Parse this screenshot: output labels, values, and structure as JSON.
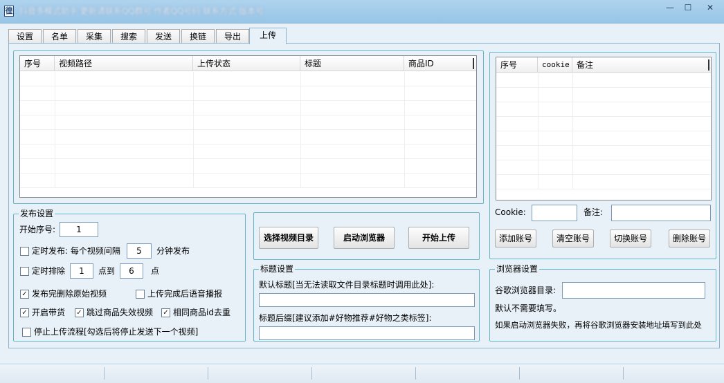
{
  "window": {
    "app_icon": "徨",
    "title": "抖音多模式助手 更新请联系QQ群号 作者QQ号码 联系方式 版本号",
    "controls": {
      "minimize": "—",
      "maximize": "☐",
      "close": "✕"
    }
  },
  "tabs": [
    {
      "label": "设置"
    },
    {
      "label": "名单"
    },
    {
      "label": "采集"
    },
    {
      "label": "搜索"
    },
    {
      "label": "发送"
    },
    {
      "label": "换链"
    },
    {
      "label": "导出"
    },
    {
      "label": "上传",
      "active": true
    }
  ],
  "video_table": {
    "columns": [
      "序号",
      "视频路径",
      "上传状态",
      "标题",
      "商品ID"
    ],
    "rows": []
  },
  "account_table": {
    "columns": [
      "序号",
      "cookie",
      "备注"
    ],
    "rows": []
  },
  "account_form": {
    "cookie_label": "Cookie:",
    "cookie_value": "",
    "note_label": "备注:",
    "note_value": "",
    "buttons": [
      "添加账号",
      "清空账号",
      "切换账号",
      "删除账号"
    ]
  },
  "publish_settings": {
    "title": "发布设置",
    "start_index_label": "开始序号:",
    "start_index_value": "1",
    "timed_publish_label": "定时发布: 每个视频间隔",
    "timed_publish_checked": false,
    "interval_value": "5",
    "interval_unit": "分钟发布",
    "timed_schedule_label": "定时排除",
    "timed_schedule_checked": false,
    "schedule_from": "1",
    "schedule_to_label": "点到",
    "schedule_to": "6",
    "schedule_unit": "点",
    "delete_after_publish_label": "发布完删除原始视频",
    "delete_after_publish_checked": true,
    "voice_notify_label": "上传完成后语音播报",
    "voice_notify_checked": false,
    "enable_goods_label": "开启带货",
    "enable_goods_checked": true,
    "skip_invalid_label": "跳过商品失效视频",
    "skip_invalid_checked": true,
    "dedupe_label": "相同商品id去重",
    "dedupe_checked": true,
    "stop_flow_label": "停止上传流程[勾选后将停止发送下一个视频]",
    "stop_flow_checked": false
  },
  "actions": {
    "select_dir": "选择视频目录",
    "launch_browser": "启动浏览器",
    "start_upload": "开始上传"
  },
  "title_settings": {
    "title": "标题设置",
    "default_title_label": "默认标题[当无法读取文件目录标题时调用此处]:",
    "default_title_value": "",
    "suffix_label": "标题后缀[建议添加#好物推荐#好物之类标签]:",
    "suffix_value": ""
  },
  "browser_settings": {
    "title": "浏览器设置",
    "dir_label": "谷歌浏览器目录:",
    "dir_value": "",
    "hint1": "默认不需要填写。",
    "hint2": "如果启动浏览器失败，再将谷歌浏览器安装地址填写到此处"
  },
  "icons": {
    "checked": "✓",
    "unchecked": ""
  }
}
